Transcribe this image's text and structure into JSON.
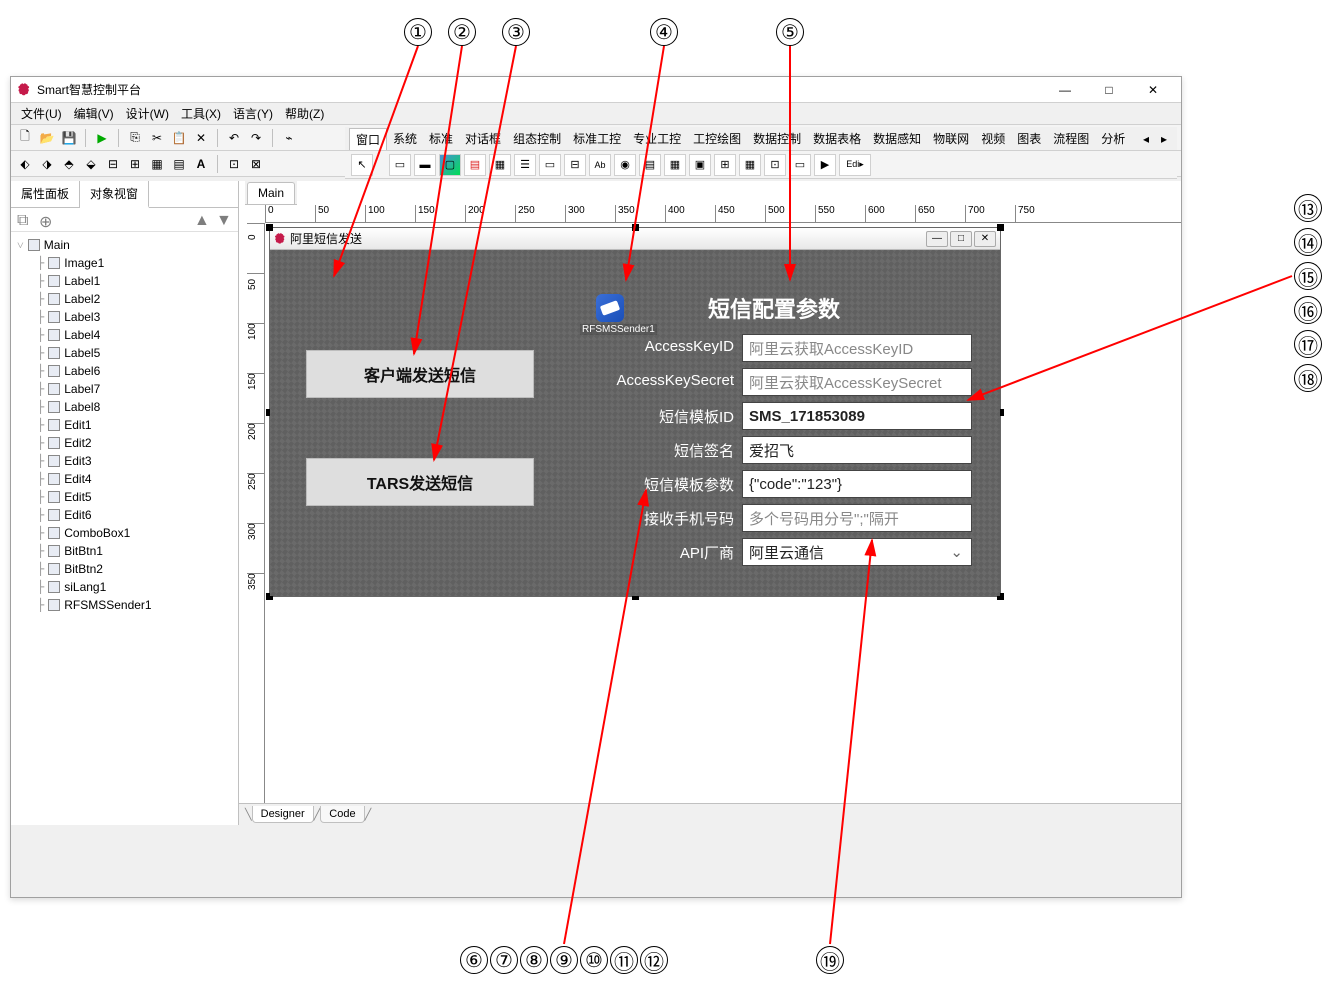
{
  "app_title": "Smart智慧控制平台",
  "menubar": [
    "文件(U)",
    "编辑(V)",
    "设计(W)",
    "工具(X)",
    "语言(Y)",
    "帮助(Z)"
  ],
  "comp_tabs": [
    "窗口",
    "系统",
    "标准",
    "对话框",
    "组态控制",
    "标准工控",
    "专业工控",
    "工控绘图",
    "数据控制",
    "数据表格",
    "数据感知",
    "物联网",
    "视频",
    "图表",
    "流程图",
    "分析"
  ],
  "side_tabs": {
    "props": "属性面板",
    "objs": "对象视窗"
  },
  "designer_tab": "Main",
  "tree": {
    "root": "Main",
    "children": [
      "Image1",
      "Label1",
      "Label2",
      "Label3",
      "Label4",
      "Label5",
      "Label6",
      "Label7",
      "Label8",
      "Edit1",
      "Edit2",
      "Edit3",
      "Edit4",
      "Edit5",
      "Edit6",
      "ComboBox1",
      "BitBtn1",
      "BitBtn2",
      "siLang1",
      "RFSMSSender1"
    ]
  },
  "form": {
    "title": "阿里短信发送",
    "btn_client": "客户端发送短信",
    "btn_tars": "TARS发送短信",
    "rfsms_label": "RFSMSSender1",
    "cfg_title": "短信配置参数",
    "labels": {
      "accesskeyid": "AccessKeyID",
      "accesskeysecret": "AccessKeySecret",
      "template_id": "短信模板ID",
      "sign": "短信签名",
      "template_param": "短信模板参数",
      "phone": "接收手机号码",
      "vendor": "API厂商"
    },
    "values": {
      "accesskeyid_ph": "阿里云获取AccessKeyID",
      "accesskeysecret_ph": "阿里云获取AccessKeySecret",
      "template_id": "SMS_171853089",
      "sign": "爱招飞",
      "template_param": "{\"code\":\"123\"}",
      "phone_ph": "多个号码用分号\";\"隔开",
      "vendor": "阿里云通信"
    }
  },
  "bottom_tabs": {
    "designer": "Designer",
    "code": "Code"
  },
  "callouts_top": [
    "①",
    "②",
    "③",
    "④",
    "⑤"
  ],
  "callouts_right": [
    "⑬",
    "⑭",
    "⑮",
    "⑯",
    "⑰",
    "⑱"
  ],
  "callouts_bottom_group": [
    "⑥",
    "⑦",
    "⑧",
    "⑨",
    "⑩",
    "⑪",
    "⑫"
  ],
  "callout_bottom_19": "⑲",
  "ruler_ticks": [
    "0",
    "50",
    "100",
    "150",
    "200",
    "250",
    "300",
    "350",
    "400",
    "450",
    "500",
    "550",
    "600",
    "650",
    "700",
    "750"
  ],
  "ruler_ticks_v": [
    "0",
    "50",
    "100",
    "150",
    "200",
    "250",
    "300",
    "350"
  ]
}
